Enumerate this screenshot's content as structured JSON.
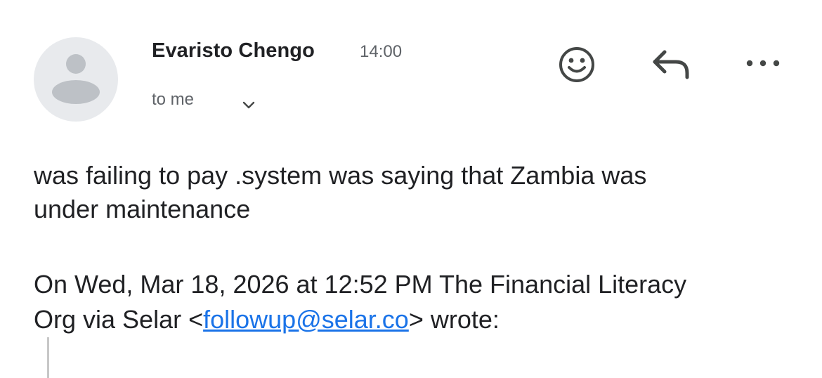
{
  "header": {
    "sender_name": "Evaristo Chengo",
    "time": "14:00",
    "recipient_label": "to me",
    "icons": {
      "avatar": "default-person-avatar",
      "details": "chevron-down-icon",
      "emoji": "smiley-face-icon",
      "reply": "reply-arrow-icon",
      "more": "more-horizontal-icon"
    }
  },
  "message": {
    "body_line1": "was failing to pay .system was saying that Zambia was",
    "body_line2": "under maintenance"
  },
  "quote": {
    "header_line1": "On Wed, Mar 18, 2026 at 12:52 PM The Financial Literacy",
    "header_prefix": "Org via Selar <",
    "email": "followup@selar.co",
    "header_suffix": "> wrote:"
  },
  "colors": {
    "link": "#1a73e8",
    "avatar_bg": "#e8eaed",
    "avatar_fg": "#bdc1c6",
    "muted_text": "#5f6368",
    "icon": "#444746"
  }
}
